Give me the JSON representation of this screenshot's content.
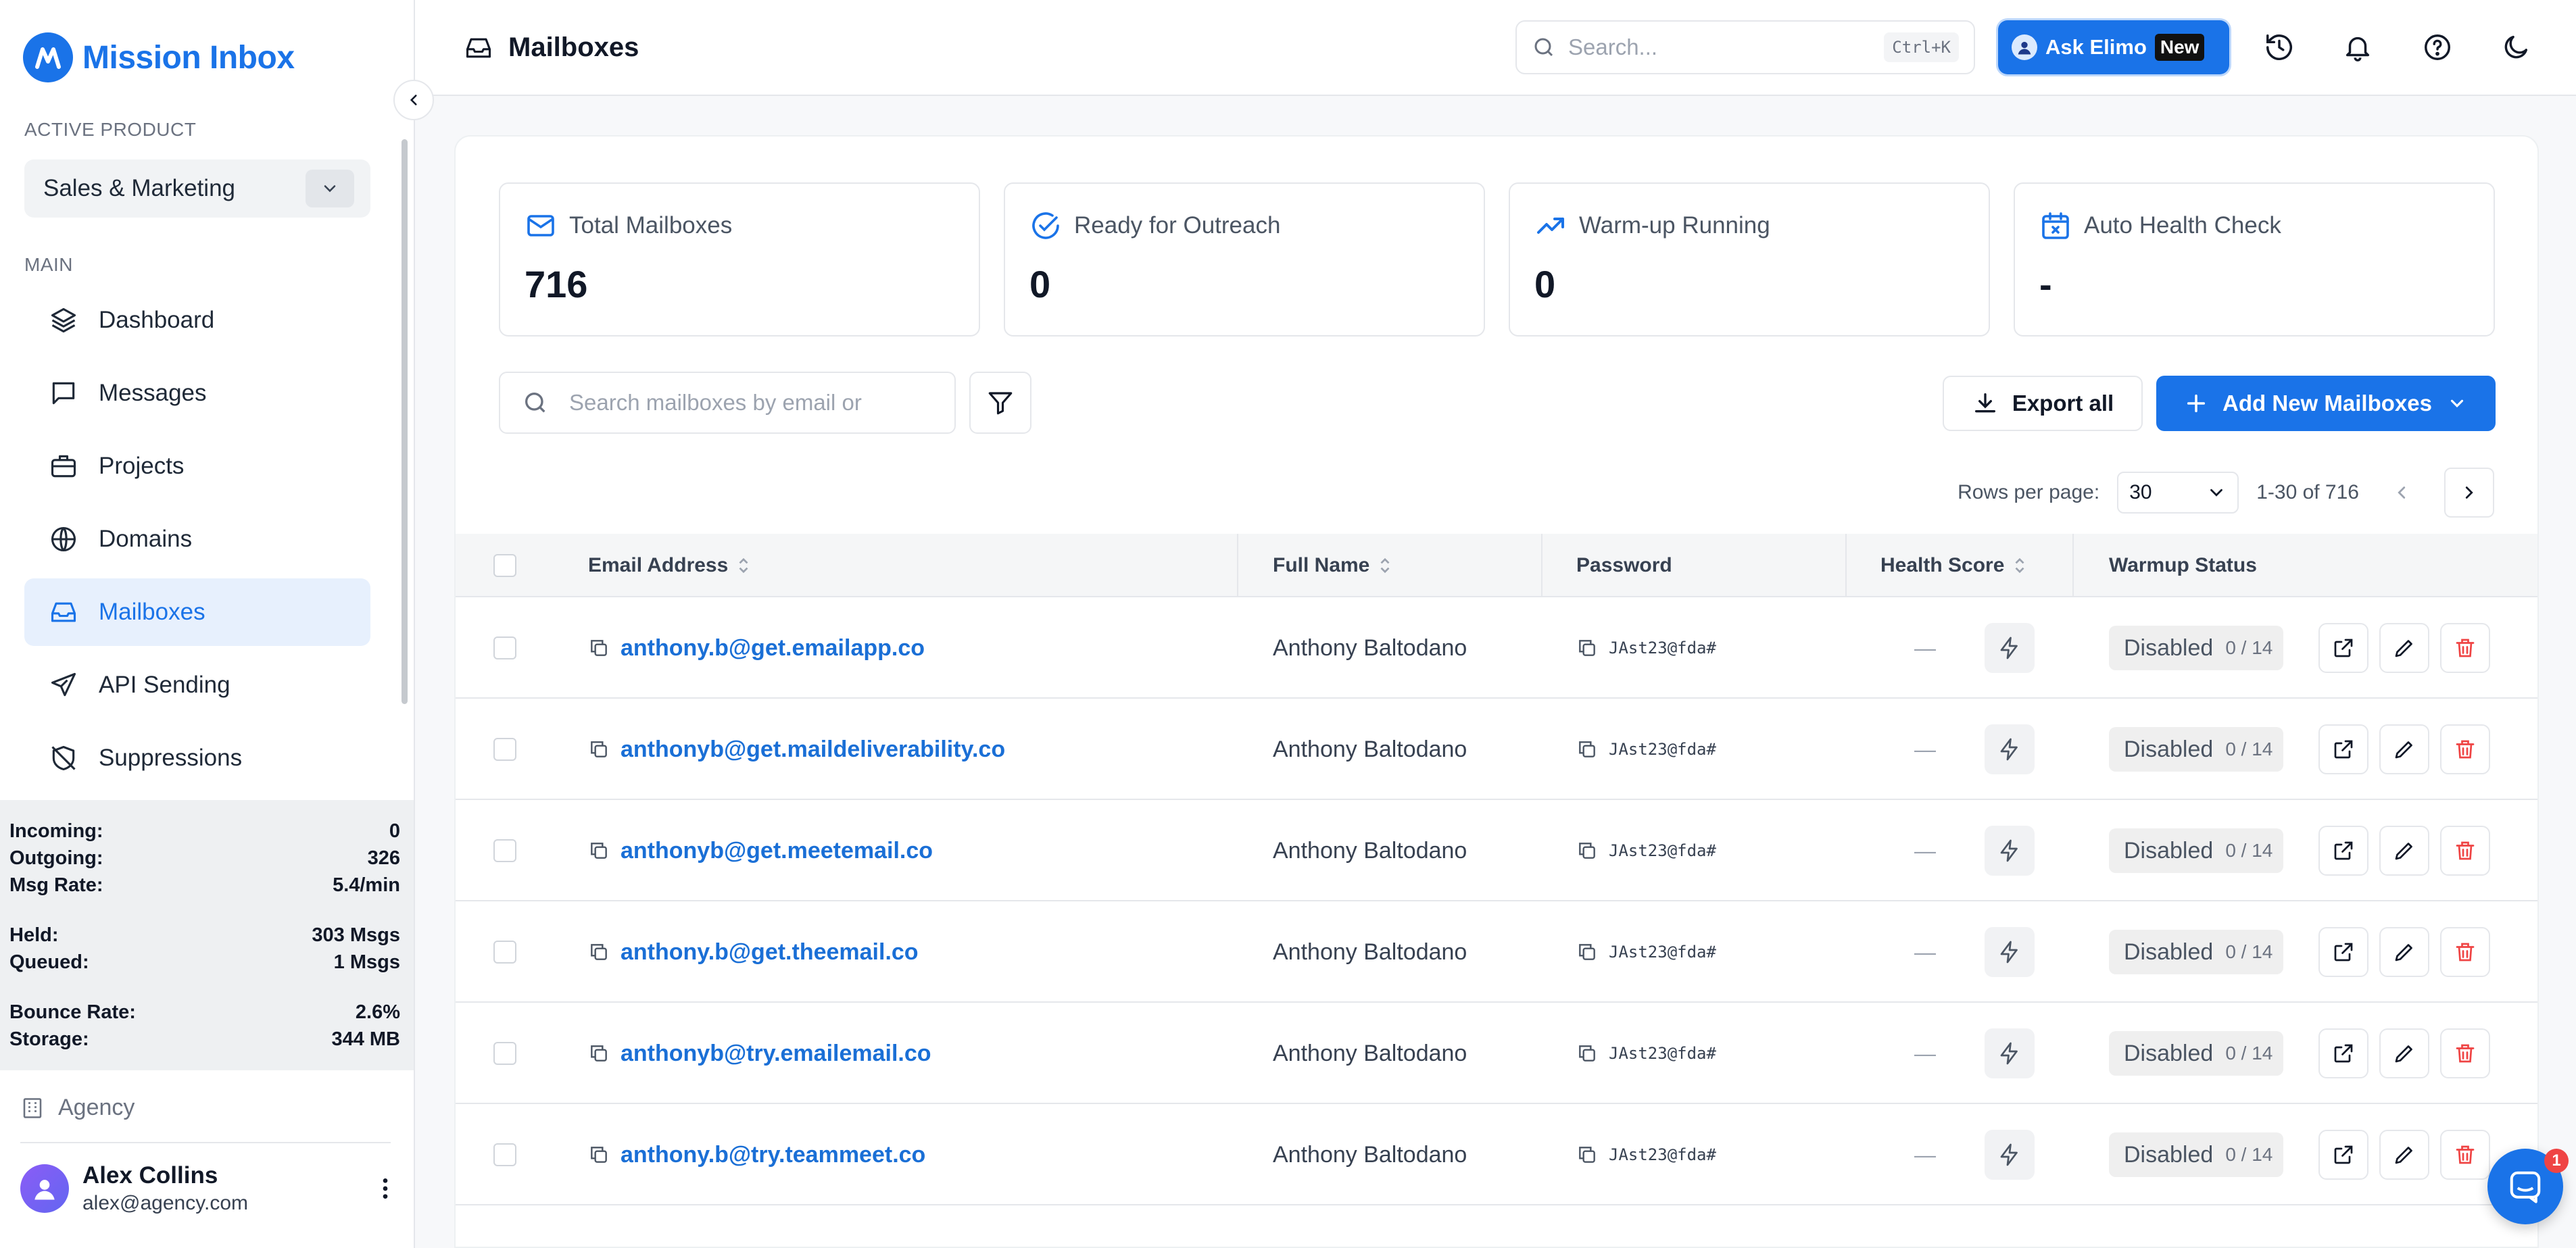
{
  "app": {
    "name": "Mission Inbox"
  },
  "sidebar": {
    "active_product_label": "ACTIVE PRODUCT",
    "product": "Sales & Marketing",
    "main_label": "MAIN",
    "items": [
      {
        "label": "Dashboard",
        "icon": "layers-icon"
      },
      {
        "label": "Messages",
        "icon": "message-icon"
      },
      {
        "label": "Projects",
        "icon": "briefcase-icon"
      },
      {
        "label": "Domains",
        "icon": "globe-icon"
      },
      {
        "label": "Mailboxes",
        "icon": "inbox-icon",
        "active": true
      },
      {
        "label": "API Sending",
        "icon": "send-icon"
      },
      {
        "label": "Suppressions",
        "icon": "shield-off-icon"
      }
    ],
    "stats": {
      "incoming_label": "Incoming:",
      "incoming": "0",
      "outgoing_label": "Outgoing:",
      "outgoing": "326",
      "rate_label": "Msg Rate:",
      "rate": "5.4/min",
      "held_label": "Held:",
      "held": "303 Msgs",
      "queued_label": "Queued:",
      "queued": "1 Msgs",
      "bounce_label": "Bounce Rate:",
      "bounce": "2.6%",
      "storage_label": "Storage:",
      "storage": "344 MB"
    },
    "agency": "Agency",
    "user": {
      "name": "Alex Collins",
      "email": "alex@agency.com"
    }
  },
  "topbar": {
    "title": "Mailboxes",
    "search_placeholder": "Search...",
    "shortcut": "Ctrl+K",
    "ask_label": "Ask Elimo",
    "new_badge": "New"
  },
  "kpis": [
    {
      "label": "Total Mailboxes",
      "value": "716",
      "icon": "mail-icon"
    },
    {
      "label": "Ready for Outreach",
      "value": "0",
      "icon": "check-circle-icon"
    },
    {
      "label": "Warm-up Running",
      "value": "0",
      "icon": "trending-up-icon"
    },
    {
      "label": "Auto Health Check",
      "value": "-",
      "icon": "calendar-x-icon"
    }
  ],
  "toolbar": {
    "search_placeholder": "Search mailboxes by email or",
    "export_label": "Export all",
    "add_label": "Add New Mailboxes"
  },
  "pagination": {
    "rows_label": "Rows per page:",
    "rows_value": "30",
    "range": "1-30 of 716"
  },
  "table": {
    "headers": {
      "email": "Email Address",
      "name": "Full Name",
      "password": "Password",
      "health": "Health Score",
      "warmup": "Warmup Status"
    },
    "rows": [
      {
        "email": "anthony.b@get.emailapp.co",
        "name": "Anthony Baltodano",
        "password": "JAst23@fda#",
        "health": "—",
        "status": "Disabled",
        "count": "0 / 14"
      },
      {
        "email": "anthonyb@get.maildeliverability.co",
        "name": "Anthony Baltodano",
        "password": "JAst23@fda#",
        "health": "—",
        "status": "Disabled",
        "count": "0 / 14"
      },
      {
        "email": "anthonyb@get.meetemail.co",
        "name": "Anthony Baltodano",
        "password": "JAst23@fda#",
        "health": "—",
        "status": "Disabled",
        "count": "0 / 14"
      },
      {
        "email": "anthony.b@get.theemail.co",
        "name": "Anthony Baltodano",
        "password": "JAst23@fda#",
        "health": "—",
        "status": "Disabled",
        "count": "0 / 14"
      },
      {
        "email": "anthonyb@try.emailemail.co",
        "name": "Anthony Baltodano",
        "password": "JAst23@fda#",
        "health": "—",
        "status": "Disabled",
        "count": "0 / 14"
      },
      {
        "email": "anthony.b@try.teammeet.co",
        "name": "Anthony Baltodano",
        "password": "JAst23@fda#",
        "health": "—",
        "status": "Disabled",
        "count": "0 / 14"
      }
    ]
  },
  "chat": {
    "badge": "1"
  },
  "colors": {
    "primary": "#1a73e8",
    "danger": "#ef4444",
    "active_bg": "#e7f0fd"
  }
}
